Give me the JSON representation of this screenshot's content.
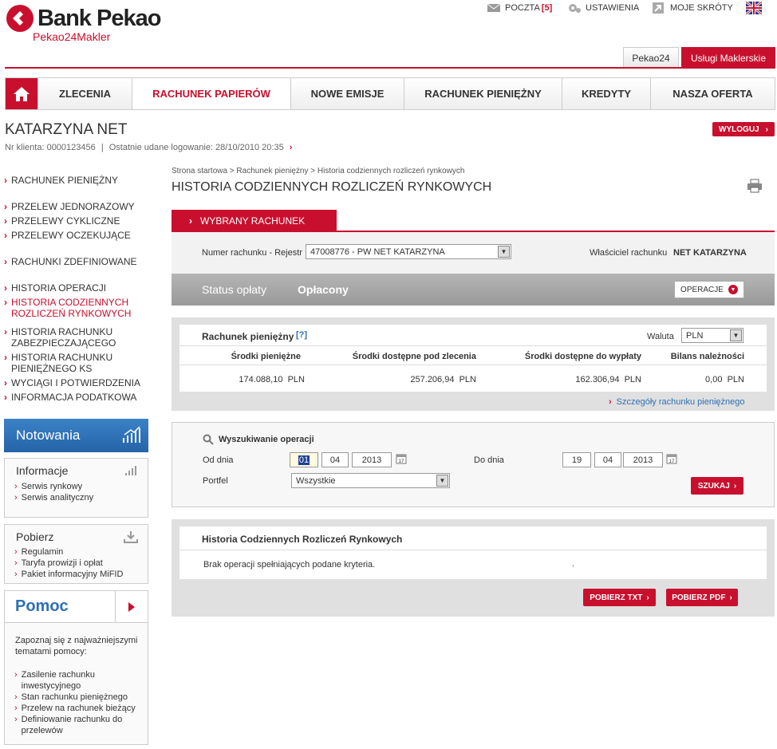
{
  "header": {
    "brand": "Bank Pekao",
    "sub_brand": "Pekao24Makler",
    "mail_label": "POCZTA",
    "mail_count": "[5]",
    "settings_label": "USTAWIENIA",
    "shortcuts_label": "MOJE SKRÓTY",
    "tabs": [
      "Pekao24",
      "Usługi Maklerskie"
    ]
  },
  "nav": [
    "ZLECENIA",
    "RACHUNEK PAPIERÓW",
    "NOWE EMISJE",
    "RACHUNEK PIENIĘŻNY",
    "KREDYTY",
    "NASZA OFERTA"
  ],
  "user": {
    "name": "KATARZYNA NET",
    "client_no": "Nr klienta: 0000123456",
    "last_login": "Ostatnie udane logowanie: 28/10/2010 20:35",
    "logout": "WYLOGUJ"
  },
  "sidebar": {
    "items": [
      "RACHUNEK PIENIĘŻNY",
      "PRZELEW JEDNORAZOWY",
      "PRZELEWY CYKLICZNE",
      "PRZELEWY OCZEKUJĄCE",
      "RACHUNKI ZDEFINIOWANE",
      "HISTORIA OPERACJI",
      "HISTORIA CODZIENNYCH ROZLICZEŃ RYNKOWYCH",
      "HISTORIA RACHUNKU ZABEZPIECZAJĄCEGO",
      "HISTORIA RACHUNKU PIENIĘŻNEGO KS",
      "WYCIĄGI I POTWIERDZENIA",
      "INFORMACJA PODATKOWA"
    ],
    "notowania": "Notowania",
    "informacje": {
      "title": "Informacje",
      "links": [
        "Serwis rynkowy",
        "Serwis analityczny"
      ]
    },
    "pobierz": {
      "title": "Pobierz",
      "links": [
        "Regulamin",
        "Taryfa prowizji i opłat",
        "Pakiet informacyjny MiFID"
      ]
    },
    "pomoc": {
      "title": "Pomoc",
      "intro": "Zapoznaj się z najważniejszymi tematami pomocy:",
      "links": [
        "Zasilenie rachunku inwestycyjnego",
        "Stan rachunku pieniężnego",
        "Przelew na rachunek bieżący",
        "Definiowanie rachunku do przelewów"
      ]
    }
  },
  "breadcrumb": "Strona startowa > Rachunek pieniężny > Historia codziennych rozliczeń rynkowych",
  "page_title": "HISTORIA CODZIENNYCH ROZLICZEŃ RYNKOWYCH",
  "account_tab": "WYBRANY RACHUNEK",
  "account": {
    "number_label": "Numer rachunku - Rejestr",
    "number_value": "47008776 - PW NET KATARZYNA",
    "owner_label": "Właściciel rachunku",
    "owner_value": "NET KATARZYNA",
    "status_label": "Status opłaty",
    "status_value": "Opłacony",
    "operations": "OPERACJE"
  },
  "cash": {
    "title": "Rachunek pieniężny",
    "help": "[?]",
    "currency_label": "Waluta",
    "currency_value": "PLN",
    "headers": [
      "Środki pieniężne",
      "Środki dostępne pod zlecenia",
      "Środki dostępne do wypłaty",
      "Bilans należności"
    ],
    "values": [
      "174.088,10",
      "257.206,94",
      "162.306,94",
      "0,00"
    ],
    "unit": "PLN",
    "details_link": "Szczegóły rachunku pieniężnego"
  },
  "search": {
    "title": "Wyszukiwanie operacji",
    "from_label": "Od dnia",
    "from": [
      "01",
      "04",
      "2013"
    ],
    "to_label": "Do dnia",
    "to": [
      "19",
      "04",
      "2013"
    ],
    "portfolio_label": "Portfel",
    "portfolio_value": "Wszystkie",
    "button": "SZUKAJ"
  },
  "history": {
    "title": "Historia Codziennych Rozliczeń Rynkowych",
    "empty": "Brak operacji spełniających podane kryteria.",
    "dot": ".",
    "btn_txt": "POBIERZ TXT",
    "btn_pdf": "POBIERZ PDF"
  },
  "colors": {
    "accent": "#c8102e",
    "blue": "#2e6fb5"
  }
}
